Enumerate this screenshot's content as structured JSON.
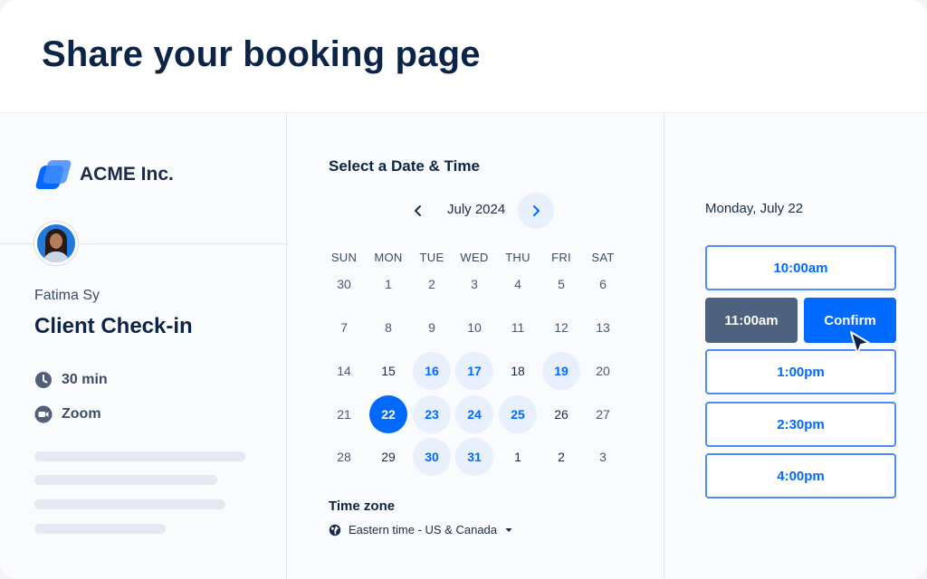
{
  "headline": "Share your booking page",
  "brand": {
    "name": "ACME Inc.",
    "logo_icon": "acme-logo-icon"
  },
  "host": {
    "name": "Fatima Sy"
  },
  "event": {
    "title": "Client Check-in",
    "duration": "30 min",
    "location": "Zoom"
  },
  "calendar": {
    "section_title": "Select a Date & Time",
    "month_label": "July 2024",
    "weekdays": [
      "SUN",
      "MON",
      "TUE",
      "WED",
      "THU",
      "FRI",
      "SAT"
    ],
    "weeks": [
      [
        {
          "d": "30",
          "s": "muted"
        },
        {
          "d": "1",
          "s": "muted"
        },
        {
          "d": "2",
          "s": "muted"
        },
        {
          "d": "3",
          "s": "muted"
        },
        {
          "d": "4",
          "s": "muted"
        },
        {
          "d": "5",
          "s": "muted"
        },
        {
          "d": "6",
          "s": "muted"
        }
      ],
      [
        {
          "d": "7",
          "s": "muted"
        },
        {
          "d": "8",
          "s": "muted"
        },
        {
          "d": "9",
          "s": "muted"
        },
        {
          "d": "10",
          "s": "muted"
        },
        {
          "d": "11",
          "s": "muted"
        },
        {
          "d": "12",
          "s": "muted"
        },
        {
          "d": "13",
          "s": "muted"
        }
      ],
      [
        {
          "d": "14",
          "s": "muted"
        },
        {
          "d": "15",
          "s": "cur"
        },
        {
          "d": "16",
          "s": "avail"
        },
        {
          "d": "17",
          "s": "avail"
        },
        {
          "d": "18",
          "s": "cur"
        },
        {
          "d": "19",
          "s": "avail"
        },
        {
          "d": "20",
          "s": "muted"
        }
      ],
      [
        {
          "d": "21",
          "s": "muted"
        },
        {
          "d": "22",
          "s": "sel"
        },
        {
          "d": "23",
          "s": "avail"
        },
        {
          "d": "24",
          "s": "avail"
        },
        {
          "d": "25",
          "s": "avail"
        },
        {
          "d": "26",
          "s": "cur"
        },
        {
          "d": "27",
          "s": "muted"
        }
      ],
      [
        {
          "d": "28",
          "s": "muted"
        },
        {
          "d": "29",
          "s": "cur"
        },
        {
          "d": "30",
          "s": "avail"
        },
        {
          "d": "31",
          "s": "avail"
        },
        {
          "d": "1",
          "s": "cur"
        },
        {
          "d": "2",
          "s": "cur"
        },
        {
          "d": "3",
          "s": "muted"
        }
      ]
    ]
  },
  "timezone": {
    "label": "Time zone",
    "value": "Eastern time - US & Canada"
  },
  "slots": {
    "date_heading": "Monday, July 22",
    "times": [
      "10:00am",
      "11:00am",
      "1:00pm",
      "2:30pm",
      "4:00pm"
    ],
    "selected_index": 1,
    "confirm_label": "Confirm"
  },
  "colors": {
    "accent": "#0069ff",
    "selected_slot": "#4e617e",
    "available_day_bg": "#e8f0fd",
    "text_dark": "#0b2447"
  }
}
